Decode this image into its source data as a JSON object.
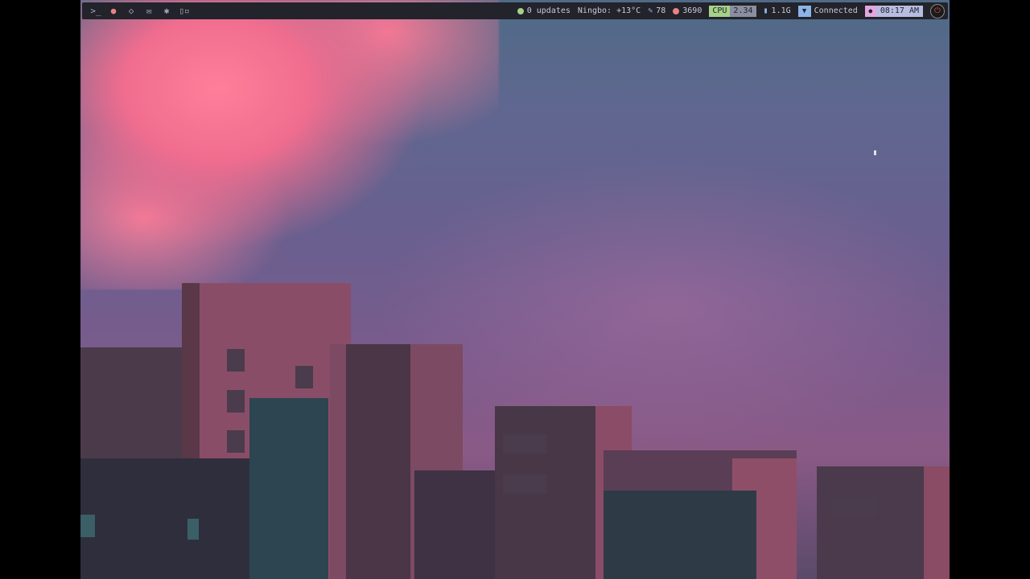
{
  "topbar": {
    "left_icons": [
      {
        "name": "terminal-icon",
        "glyph": ">_"
      },
      {
        "name": "firefox-icon",
        "glyph": "●"
      },
      {
        "name": "pocket-icon",
        "glyph": "◇"
      },
      {
        "name": "mail-icon",
        "glyph": "✉"
      },
      {
        "name": "settings-icon",
        "glyph": "✱"
      },
      {
        "name": "layout-icon",
        "glyph": "▯▫"
      }
    ],
    "updates": "0 updates",
    "weather": "Ningbo: +13°C",
    "brightness": "78",
    "memory": "3690",
    "cpu_label": "CPU",
    "cpu_value": "2.34",
    "disk": "1.1G",
    "network": "Connected",
    "clock": "08:17 AM"
  },
  "colors": {
    "bar_bg": "#22232b",
    "updates": "#a6d189",
    "brightness": "#8cb4e8",
    "memory": "#e78284",
    "cpu": "#a6d189",
    "wifi": "#8cb4e8",
    "clock": "#b7bde0"
  }
}
